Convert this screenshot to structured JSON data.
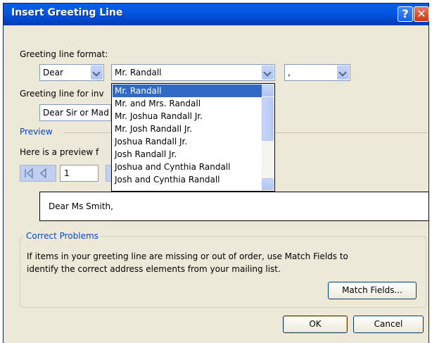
{
  "dialog": {
    "title": "Insert Greeting Line",
    "help_label": "?",
    "close_label": "✕"
  },
  "greeting_format": {
    "label": "Greeting line format:",
    "salutation": "Dear",
    "name_format": "Mr. Randall",
    "punctuation": ","
  },
  "invalid": {
    "label": "Greeting line for inv",
    "value": "Dear Sir or Mad"
  },
  "preview": {
    "heading": "Preview",
    "label": "Here is a preview f",
    "record": "1",
    "text": "Dear Ms Smith,"
  },
  "dropdown": {
    "items": [
      "Mr. Randall",
      "Mr. and Mrs. Randall",
      "Mr. Joshua Randall Jr.",
      "Mr. Josh Randall Jr.",
      "Joshua Randall Jr.",
      "Josh Randall Jr.",
      "Joshua and Cynthia Randall",
      "Josh and Cynthia Randall"
    ],
    "selected_index": 0
  },
  "correct_problems": {
    "heading": "Correct Problems",
    "text_line1": "If items in your greeting line are missing or out of order, use Match Fields to",
    "text_line2": "identify the correct address elements from your mailing list.",
    "match_fields": "Match Fields..."
  },
  "buttons": {
    "ok": "OK",
    "cancel": "Cancel"
  },
  "colors": {
    "title_bar": "#0458e4",
    "selection": "#316ac5",
    "dialog_bg": "#ece9d8"
  }
}
